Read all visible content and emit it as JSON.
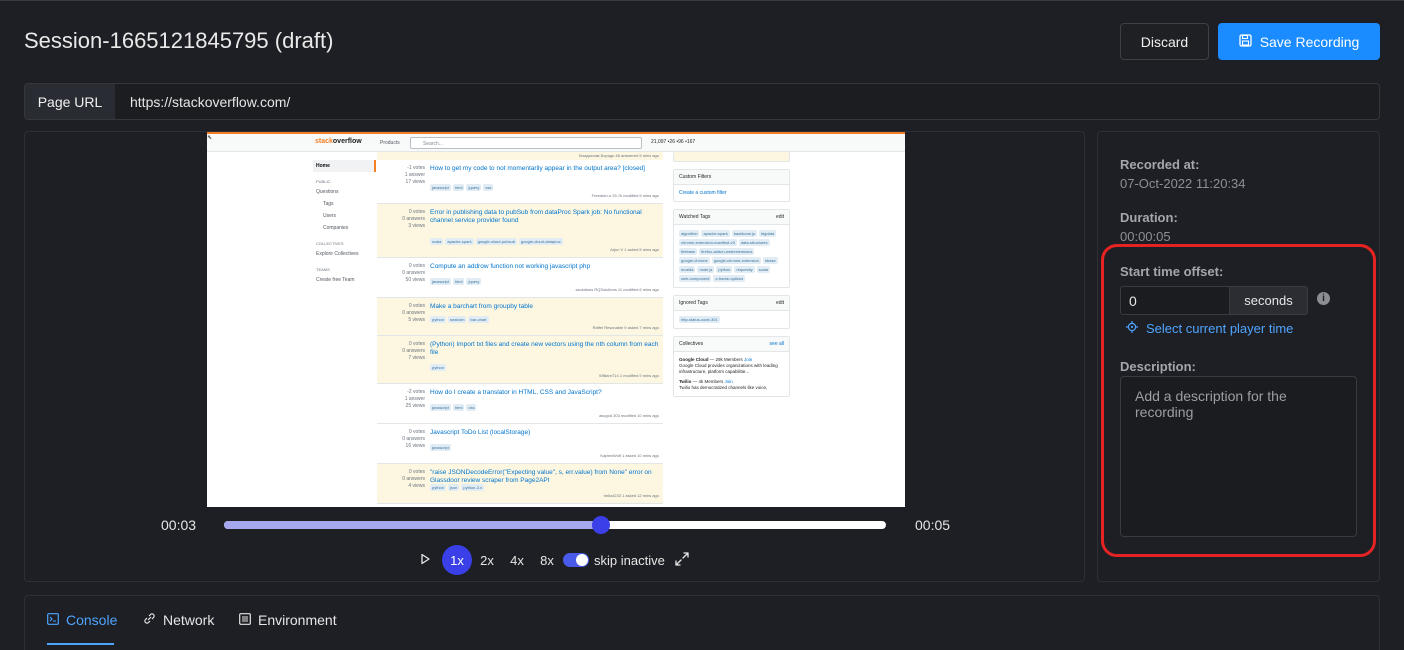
{
  "header": {
    "title": "Session-1665121845795 (draft)",
    "discard_label": "Discard",
    "save_label": "Save Recording"
  },
  "urlbar": {
    "label": "Page URL",
    "value": "https://stackoverflow.com/"
  },
  "player": {
    "current_time": "00:03",
    "total_time": "00:05",
    "progress": 0.57,
    "speeds": [
      "1x",
      "2x",
      "4x",
      "8x"
    ],
    "active_speed": "1x",
    "skip_inactive_label": "skip inactive",
    "skip_inactive": true
  },
  "details": {
    "recorded_at_label": "Recorded at:",
    "recorded_at": "07-Oct-2022 11:20:34",
    "duration_label": "Duration:",
    "duration": "00:00:05",
    "start_offset_label": "Start time offset:",
    "start_offset_value": "0",
    "start_offset_unit": "seconds",
    "select_time_label": "Select current player time",
    "description_label": "Description:",
    "description_placeholder": "Add a description for the recording"
  },
  "tabs": {
    "console": "Console",
    "network": "Network",
    "environment": "Environment",
    "active": "Console"
  },
  "embedded_page": {
    "logo_prefix": "stack",
    "logo_suffix": "overflow",
    "products": "Products",
    "search_placeholder": "Search...",
    "reputation": "21,097 •26 •96 •167",
    "nav": {
      "home": "Home",
      "public": "PUBLIC",
      "questions": "Questions",
      "tags": "Tags",
      "users": "Users",
      "companies": "Companies",
      "collectives": "COLLECTIVES",
      "explore": "Explore Collectives",
      "teams": "TEAMS",
      "create_team": "Create free Team"
    },
    "top_meta": "Владислав Бородь 48 answered 5 mins ago",
    "questions": [
      {
        "votes": "-1 votes",
        "answers": "1 answer",
        "views": "17 views",
        "title": "How to get my code to not momentarily appear in the output area? [closed]",
        "tags": [
          "javascript",
          "html",
          "jquery",
          "css"
        ],
        "meta": "Freedom-n 25.7k modified 5 mins ago",
        "watched": false
      },
      {
        "votes": "0 votes",
        "answers": "0 answers",
        "views": "3 views",
        "title": "Error in publishing data to pubSub from dataProc Spark job: No functional channel service provider found",
        "tags": [
          "scala",
          "apache-spark",
          "google-cloud-pubsub",
          "google-cloud-dataproc"
        ],
        "meta": "Arjun V 1 asked 5 mins ago",
        "watched": true
      },
      {
        "votes": "0 votes",
        "answers": "0 answers",
        "views": "50 views",
        "title": "Compute an addrow function not working javascript php",
        "tags": [
          "javascript",
          "html",
          "jquery"
        ],
        "meta": "ssolutions RQSolutions 11 modified 6 mins ago",
        "watched": false
      },
      {
        "votes": "0 votes",
        "answers": "0 answers",
        "views": "5 views",
        "title": "Make a barchart from groupby table",
        "tags": [
          "python",
          "seaborn",
          "bar-chart"
        ],
        "meta": "Raffel Resonable 9 asked 7 mins ago",
        "watched": true
      },
      {
        "votes": "0 votes",
        "answers": "0 answers",
        "views": "7 views",
        "title": "(Python) Import txt files and create new vectors using the nth column from each file",
        "tags": [
          "python"
        ],
        "meta": "WilliamT14 1 modified 9 mins ago",
        "watched": true
      },
      {
        "votes": "-2 votes",
        "answers": "1 answer",
        "views": "25 views",
        "title": "How do I create a translator in HTML, CSS and JavaScript?",
        "tags": [
          "javascript",
          "html",
          "css"
        ],
        "meta": "ascgod 303 modified 10 mins ago",
        "watched": false
      },
      {
        "votes": "0 votes",
        "answers": "0 answers",
        "views": "16 views",
        "title": "Javascript ToDo List (localStorage)",
        "tags": [
          "javascript"
        ],
        "meta": "KaptenWolf 1 asked 10 mins ago",
        "watched": false
      },
      {
        "votes": "0 votes",
        "answers": "0 answers",
        "views": "4 views",
        "title": "\"raise JSONDecodeError(\"Expecting value\", s, err.value) from None\" error on Glassdoor review scraper from Page2API",
        "tags": [
          "python",
          "json",
          "python-3.x"
        ],
        "meta": "hello4233 1 asked 12 mins ago",
        "watched": true
      }
    ],
    "custom_filters": "Custom Filters",
    "create_filter": "Create a custom filter",
    "watched_tags": "Watched Tags",
    "edit": "edit",
    "watched_list": [
      "algorithm",
      "apache-spark",
      "backbone.js",
      "bigdata",
      "chrome-extension-manifest-v3",
      "data-structures",
      "firebase",
      "firefox-addon-webextensions",
      "google-chrome",
      "google-chrome-extension",
      "hbase",
      "mozilla",
      "node.js",
      "python",
      "requestly",
      "scala",
      "web-component",
      "x-frame-options"
    ],
    "ignored_tags": "Ignored Tags",
    "ignored_list": [
      "http-status-code-301"
    ],
    "collectives": "Collectives",
    "see_all": "see all",
    "collective_1": "Google Cloud",
    "collective_1_members": "29k Members",
    "collective_1_desc": "Google Cloud provides organizations with leading infrastructure, platform capabilitie...",
    "collective_2": "Twilio",
    "collective_2_members": "4k Members",
    "collective_2_desc": "Twilio has democratized channels like voice,",
    "join": "Join"
  }
}
